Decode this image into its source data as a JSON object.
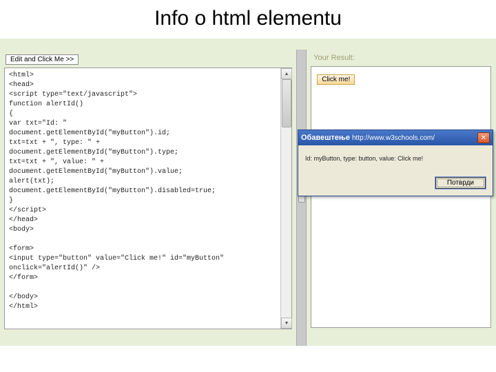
{
  "slide": {
    "title": "Info o html elementu"
  },
  "editor": {
    "edit_button": "Edit and Click Me >>",
    "code_lines": [
      "<html>",
      "<head>",
      "<script type=\"text/javascript\">",
      "function alertId()",
      "{",
      "var txt=\"Id: \"",
      "document.getElementById(\"myButton\").id;",
      "txt=txt + \", type: \" +",
      "document.getElementById(\"myButton\").type;",
      "txt=txt + \", value: \" +",
      "document.getElementById(\"myButton\").value;",
      "alert(txt);",
      "document.getElementById(\"myButton\").disabled=true;",
      "}",
      "</script>",
      "</head>",
      "<body>",
      "",
      "<form>",
      "<input type=\"button\" value=\"Click me!\" id=\"myButton\"",
      "onclick=\"alertId()\" />",
      "</form>",
      "",
      "</body>",
      "</html>"
    ]
  },
  "result": {
    "label": "Your Result:",
    "button": "Click me!"
  },
  "dialog": {
    "title_prefix": "Обавештење",
    "title_url": "http://www.w3schools.com/",
    "message": "Id: myButton, type: button, value: Click me!",
    "ok": "Потврди"
  }
}
